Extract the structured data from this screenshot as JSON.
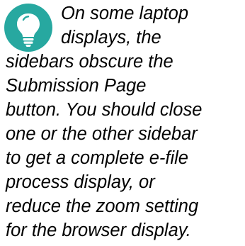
{
  "tip": {
    "icon": "lightbulb-icon",
    "icon_color": "#27a8a0",
    "lines": [
      "On some laptop",
      "displays, the",
      "sidebars obscure the",
      "Submission Page",
      "button. You should close",
      "one or the other sidebar",
      "to get a complete e-file",
      "process display, or",
      "reduce the zoom setting",
      "for the browser display."
    ]
  }
}
